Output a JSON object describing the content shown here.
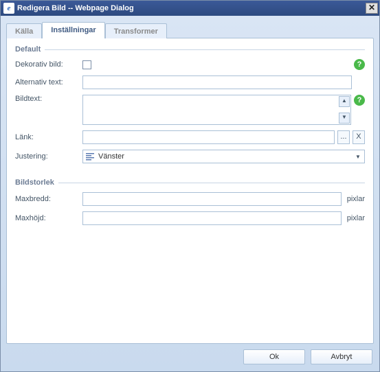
{
  "window": {
    "title": "Redigera Bild -- Webpage Dialog"
  },
  "tabs": {
    "kalla": "Källa",
    "installningar": "Inställningar",
    "transformer": "Transformer"
  },
  "default_group": {
    "legend": "Default",
    "dekorativ_bild_label": "Dekorativ bild:",
    "alt_text_label": "Alternativ text:",
    "alt_text_value": "",
    "bildtext_label": "Bildtext:",
    "bildtext_value": "",
    "lank_label": "Länk:",
    "lank_value": "",
    "justering_label": "Justering:",
    "justering_value": "Vänster"
  },
  "size_group": {
    "legend": "Bildstorlek",
    "maxbredd_label": "Maxbredd:",
    "maxbredd_value": "",
    "maxhojd_label": "Maxhöjd:",
    "maxhojd_value": "",
    "unit": "pixlar"
  },
  "footer": {
    "ok": "Ok",
    "avbryt": "Avbryt"
  },
  "icons": {
    "help": "?",
    "browse": "...",
    "clear": "X",
    "arrow_up": "▲",
    "arrow_down": "▼",
    "combo_dropdown": "▼"
  }
}
